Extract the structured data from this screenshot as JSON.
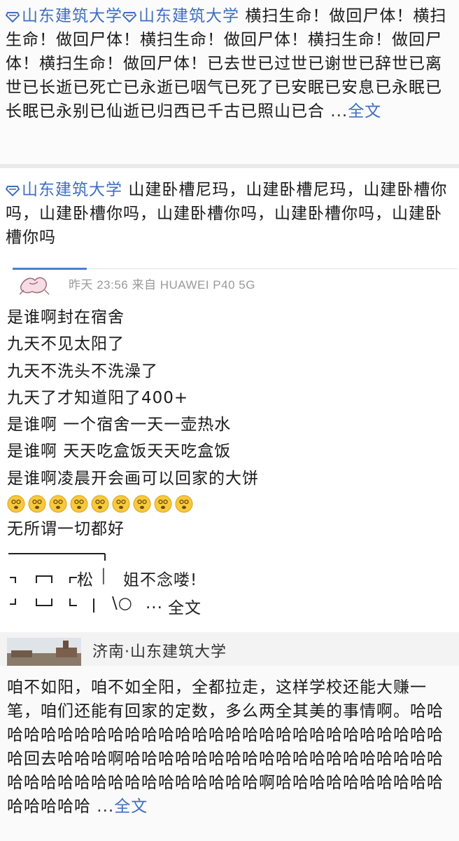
{
  "post1": {
    "topic1": "山东建筑大学",
    "topic2": "山东建筑大学",
    "body": "横扫生命！做回尸体！横扫生命！做回尸体！横扫生命！做回尸体！横扫生命！做回尸体！横扫生命！做回尸体！已去世已过世已谢世已辞世已离世已长逝已死亡已永逝已咽气已死了已安眠已安息已永眠已长眠已永别已仙逝已归西已千古已照山已合",
    "ellipsis": " ...",
    "more": "全文"
  },
  "post2": {
    "topic": "山东建筑大学",
    "body": "山建卧槽尼玛，山建卧槽尼玛，山建卧槽你吗，山建卧槽你吗，山建卧槽你吗，山建卧槽你吗，山建卧槽你吗"
  },
  "post3": {
    "meta": "昨天 23:56 来自 HUAWEI P40 5G",
    "lines": [
      "是谁啊封在宿舍",
      "九天不见太阳了",
      "九天不洗头不洗澡了",
      "九天了才知道阳了400+",
      "是谁啊 一个宿舍一天一壶热水",
      "是谁啊 天天吃盒饭天天吃盒饭",
      "是谁啊凌晨开会画可以回家的大饼"
    ],
    "emoji_count": 9,
    "after_emoji": "无所谓一切都好",
    "ascii_word1": "松",
    "ascii_bar": "|",
    "ascii_text": "姐不念喽!",
    "ascii_tail": "\\○",
    "ellipsis": " ...",
    "more": "全文",
    "location": "济南·山东建筑大学"
  },
  "post4": {
    "body": "咱不如阳，咱不如全阳，全都拉走，这样学校还能大赚一笔，咱们还能有回家的定数，多么两全其美的事情啊。哈哈哈哈哈哈哈哈哈哈哈哈哈哈哈哈哈哈哈哈哈哈哈哈哈哈哈哈哈回去哈哈哈啊哈哈哈哈哈哈哈哈哈哈哈哈哈哈哈哈哈哈哈哈哈哈哈哈哈哈哈哈哈哈哈哈哈哈啊哈哈哈哈哈哈哈哈哈哈哈哈哈哈哈",
    "ellipsis": " ...",
    "more": "全文"
  },
  "colors": {
    "link": "#3f6fc0",
    "meta": "#9a9a9a"
  },
  "icons": {
    "topic": "topic-diamond-icon",
    "emoji": "dizzy-face-emoji",
    "location": "location-pin-icon"
  }
}
